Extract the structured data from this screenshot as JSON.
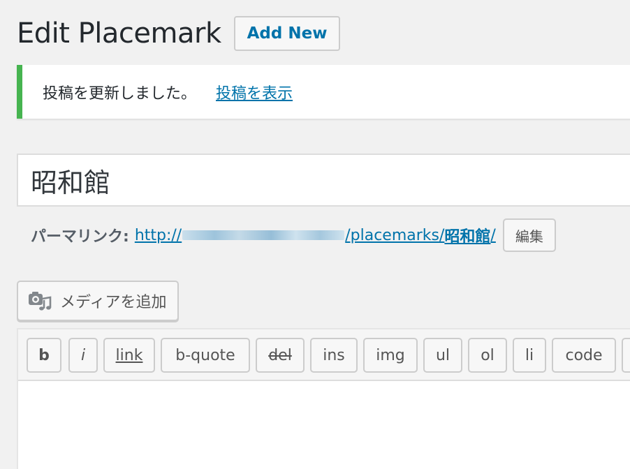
{
  "header": {
    "title": "Edit Placemark",
    "add_new_label": "Add New"
  },
  "notice": {
    "message": "投稿を更新しました。",
    "link_label": "投稿を表示"
  },
  "post": {
    "title": "昭和館"
  },
  "permalink": {
    "label": "パーマリンク:",
    "url_prefix": "http://",
    "url_path": "/placemarks/",
    "slug": "昭和館",
    "url_suffix": "/",
    "edit_label": "編集"
  },
  "media": {
    "add_media_label": "メディアを追加",
    "icon": "add-media-icon"
  },
  "quicktags": {
    "buttons": [
      "b",
      "i",
      "link",
      "b-quote",
      "del",
      "ins",
      "img",
      "ul",
      "ol",
      "li",
      "code"
    ]
  },
  "colors": {
    "link": "#0073aa",
    "notice_success": "#46b450",
    "text": "#23282d"
  }
}
